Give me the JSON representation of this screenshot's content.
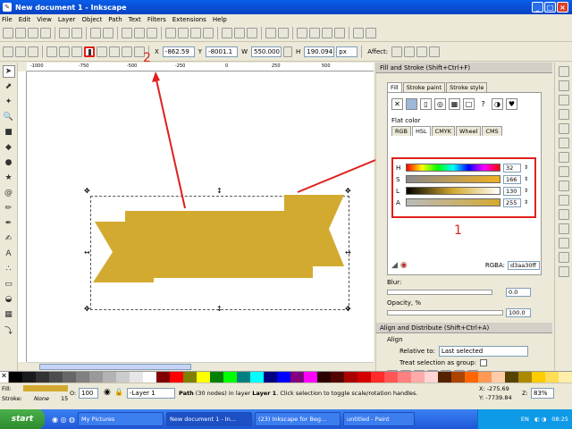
{
  "window": {
    "title": "New document 1 - Inkscape"
  },
  "menu": [
    "File",
    "Edit",
    "View",
    "Layer",
    "Object",
    "Path",
    "Text",
    "Filters",
    "Extensions",
    "Help"
  ],
  "controls": {
    "x_label": "X",
    "x_value": "-862.59",
    "y_label": "Y",
    "y_value": "-8001.1",
    "w_label": "W",
    "w_value": "550.000",
    "h_label": "H",
    "h_value": "190.094",
    "unit": "px",
    "affect_label": "Affect:"
  },
  "annotations": {
    "label1": "1",
    "label2": "2"
  },
  "fill_stroke": {
    "title": "Fill and Stroke (Shift+Ctrl+F)",
    "tabs": [
      "Fill",
      "Stroke paint",
      "Stroke style"
    ],
    "flat_color_label": "Flat color",
    "color_tabs": [
      "RGB",
      "HSL",
      "CMYK",
      "Wheel",
      "CMS"
    ],
    "sliders": [
      {
        "label": "H",
        "value": "32"
      },
      {
        "label": "S",
        "value": "166"
      },
      {
        "label": "L",
        "value": "130"
      },
      {
        "label": "A",
        "value": "255"
      }
    ],
    "rgba_label": "RGBA:",
    "rgba_value": "d3aa30ff",
    "blur_label": "Blur:",
    "blur_value": "0.0",
    "opacity_label": "Opacity, %",
    "opacity_value": "100.0"
  },
  "align": {
    "title": "Align and Distribute (Shift+Ctrl+A)",
    "align_label": "Align",
    "relative_label": "Relative to:",
    "relative_value": "Last selected",
    "group_label": "Treat selection as group:"
  },
  "colors": {
    "banner": "#d3aa30",
    "annotation": "#e0201c"
  },
  "status": {
    "fill_label": "Fill:",
    "stroke_label": "Stroke:",
    "stroke_value": "None",
    "stroke_width": "15",
    "opacity_label": "O:",
    "opacity_value": "100",
    "layer": "-Layer 1",
    "message_bold": "Path",
    "message": " (30 nodes) in layer ",
    "message_layer": "Layer 1",
    "message_tail": ". Click selection to toggle scale/rotation handles.",
    "x_coord": "X: -275.69",
    "y_coord": "Y: -7739.84",
    "zoom_label": "Z:",
    "zoom_value": "83%"
  },
  "taskbar": {
    "start": "start",
    "tasks": [
      "My Pictures",
      "New document 1 - In...",
      "(23) Inkscape for Beg...",
      "untitled - Paint"
    ],
    "lang": "EN",
    "clock": "08:25"
  },
  "ruler": {
    "ticks": [
      "-1000",
      "-750",
      "-500",
      "-250",
      "0",
      "250",
      "500"
    ]
  }
}
